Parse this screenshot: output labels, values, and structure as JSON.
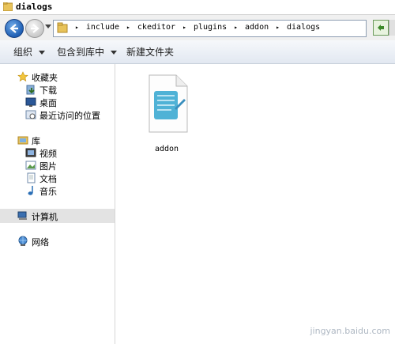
{
  "window": {
    "title": "dialogs"
  },
  "address": {
    "crumbs": [
      "include",
      "ckeditor",
      "plugins",
      "addon",
      "dialogs"
    ]
  },
  "toolbar": {
    "organize": "组织",
    "include_in_library": "包含到库中",
    "new_folder": "新建文件夹"
  },
  "nav": {
    "favorites": "收藏夹",
    "downloads": "下载",
    "desktop": "桌面",
    "recent": "最近访问的位置",
    "libraries": "库",
    "videos": "视频",
    "pictures": "图片",
    "documents": "文档",
    "music": "音乐",
    "computer": "计算机",
    "network": "网络"
  },
  "content": {
    "files": [
      {
        "name": "addon",
        "icon": "notepad-file-icon"
      }
    ]
  },
  "watermark": "jingyan.baidu.com",
  "colors": {
    "accent": "#1f5fb4",
    "selection": "#e3e3e3",
    "toolbar": "#e2e8f1"
  }
}
